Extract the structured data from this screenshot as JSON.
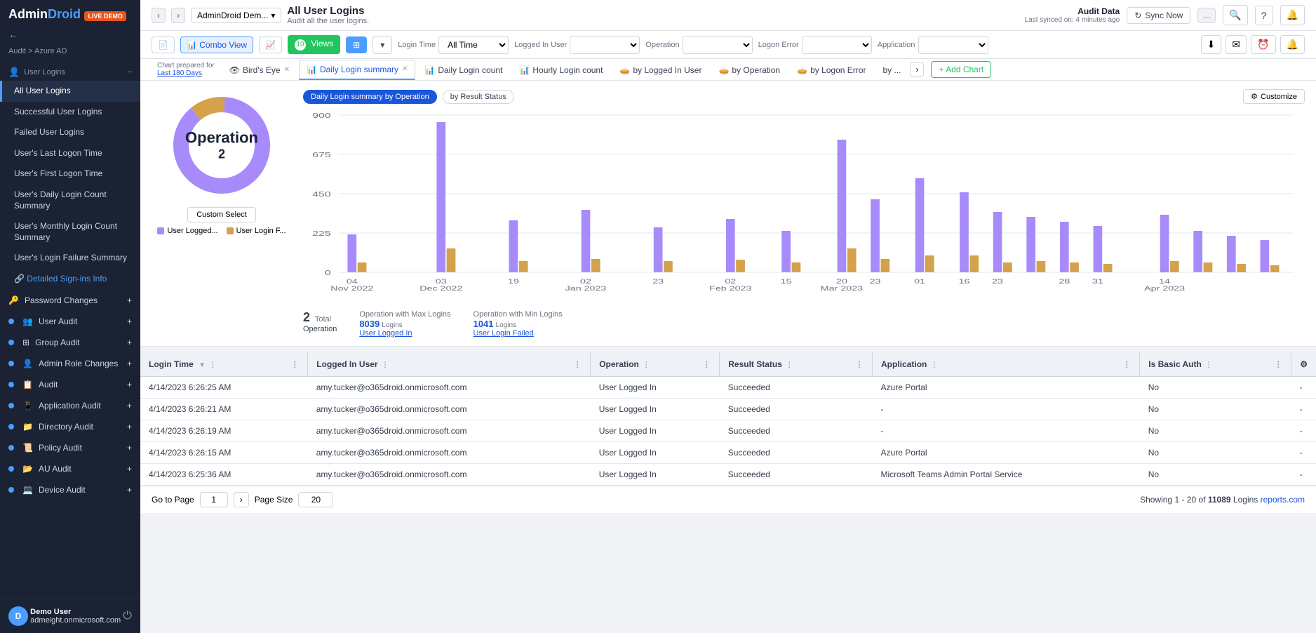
{
  "app": {
    "logo": "AdminDroid",
    "logo_highlight": "Droid",
    "live_demo": "LIVE DEMO"
  },
  "topbar": {
    "nav_back": "‹",
    "nav_forward": "›",
    "breadcrumb": "AdminDroid Dem...",
    "title": "All User Logins",
    "subtitle": "Audit all the user logins.",
    "audit_data_title": "Audit Data",
    "last_synced": "Last synced on: 4 minutes ago",
    "sync_now": "Sync Now",
    "more_options": "...",
    "search_icon": "🔍",
    "help_icon": "?",
    "bell_icon": "🔔"
  },
  "filters": {
    "view1_icon": "📄",
    "combo_view": "Combo View",
    "chart_view": "📊",
    "views_count": "10",
    "views_label": "Views",
    "filter_icon": "⊞",
    "login_time_label": "Login Time",
    "login_time_value": "All Time",
    "logged_in_user_label": "Logged In User",
    "operation_label": "Operation",
    "logon_error_label": "Logon Error",
    "application_label": "Application",
    "download_icon": "⬇",
    "mail_icon": "✉",
    "clock_icon": "⏰",
    "alert_icon": "🔔"
  },
  "chart_tabs": {
    "prepared_for": "Chart prepared for",
    "days": "Last 180 Days",
    "birds_eye": "Bird's Eye",
    "daily_login_summary": "Daily Login summary",
    "daily_login_count": "Daily Login count",
    "hourly_login_count": "Hourly Login count",
    "by_logged_in_user": "by Logged In User",
    "by_operation": "by Operation",
    "by_logon_error": "by Logon Error",
    "by_arrow": "by ...",
    "add_chart": "+ Add Chart"
  },
  "chart": {
    "sub_tabs": [
      "Daily Login summary by Operation",
      "by Result Status"
    ],
    "active_sub_tab": 0,
    "customize": "Customize",
    "donut": {
      "label": "Operation",
      "count": "2",
      "custom_select": "Custom Select",
      "legend": [
        {
          "label": "User Logged...",
          "color": "#a78bfa"
        },
        {
          "label": "User Login F...",
          "color": "#d4a24a"
        }
      ]
    },
    "bar_chart": {
      "y_labels": [
        "900",
        "675",
        "450",
        "225",
        "0"
      ],
      "x_labels": [
        {
          "label": "04",
          "month": "Nov 2022"
        },
        {
          "label": "03",
          "month": "Dec 2022"
        },
        {
          "label": "19",
          "month": ""
        },
        {
          "label": "02",
          "month": "Jan 2023"
        },
        {
          "label": "23",
          "month": ""
        },
        {
          "label": "02",
          "month": "Feb 2023"
        },
        {
          "label": "15",
          "month": ""
        },
        {
          "label": "20",
          "month": "Mar 2023"
        },
        {
          "label": "23",
          "month": ""
        },
        {
          "label": "01",
          "month": ""
        },
        {
          "label": "16",
          "month": ""
        },
        {
          "label": "23",
          "month": ""
        },
        {
          "label": "28",
          "month": ""
        },
        {
          "label": "31",
          "month": ""
        },
        {
          "label": "14",
          "month": "Apr 2023"
        }
      ]
    },
    "stats": {
      "total_operation": "2",
      "total_operation_label": "Total",
      "total_operation_sub": "Operation",
      "max_logins_label": "Operation with Max Logins",
      "max_logins_name": "User Logged In",
      "max_logins_count": "8039",
      "max_logins_unit": "Logins",
      "min_logins_label": "Operation with Min Logins",
      "min_logins_name": "User Login Failed",
      "min_logins_count": "1041",
      "min_logins_unit": "Logins"
    }
  },
  "table": {
    "columns": [
      {
        "label": "Login Time",
        "sortable": true
      },
      {
        "label": "Logged In User",
        "sortable": false
      },
      {
        "label": "Operation",
        "sortable": false
      },
      {
        "label": "Result Status",
        "sortable": false
      },
      {
        "label": "Application",
        "sortable": false
      },
      {
        "label": "Is Basic Auth",
        "sortable": false
      }
    ],
    "rows": [
      {
        "login_time": "4/14/2023 6:26:25 AM",
        "user": "amy.tucker@o365droid.onmicrosoft.com",
        "operation": "User Logged In",
        "result": "Succeeded",
        "application": "Azure Portal",
        "is_basic_auth": "No"
      },
      {
        "login_time": "4/14/2023 6:26:21 AM",
        "user": "amy.tucker@o365droid.onmicrosoft.com",
        "operation": "User Logged In",
        "result": "Succeeded",
        "application": "-",
        "is_basic_auth": "No"
      },
      {
        "login_time": "4/14/2023 6:26:19 AM",
        "user": "amy.tucker@o365droid.onmicrosoft.com",
        "operation": "User Logged In",
        "result": "Succeeded",
        "application": "-",
        "is_basic_auth": "No"
      },
      {
        "login_time": "4/14/2023 6:26:15 AM",
        "user": "amy.tucker@o365droid.onmicrosoft.com",
        "operation": "User Logged In",
        "result": "Succeeded",
        "application": "Azure Portal",
        "is_basic_auth": "No"
      },
      {
        "login_time": "4/14/2023 6:25:36 AM",
        "user": "amy.tucker@o365droid.onmicrosoft.com",
        "operation": "User Logged In",
        "result": "Succeeded",
        "application": "Microsoft Teams Admin Portal Service",
        "is_basic_auth": "No"
      }
    ]
  },
  "pagination": {
    "go_to_page_label": "Go to Page",
    "page_value": "1",
    "page_size_label": "Page Size",
    "page_size_value": "20",
    "showing": "Showing 1 - 20 of",
    "total": "11089",
    "logins": "Logins",
    "reports_link": "reports.com"
  },
  "sidebar": {
    "back_arrow": "←",
    "breadcrumb": "Audit > Azure AD",
    "user_logins": {
      "label": "User Logins",
      "collapse": "−",
      "items": [
        "All User Logins",
        "Successful User Logins",
        "Failed User Logins",
        "User's Last Logon Time",
        "User's First Logon Time",
        "User's Daily Login Count Summary",
        "User's Monthly Login Count Summary",
        "User's Login Failure Summary",
        "Detailed Sign-ins Info"
      ]
    },
    "groups": [
      {
        "label": "Password Changes",
        "dot": "blue",
        "expand": "+"
      },
      {
        "label": "User Audit",
        "dot": "blue",
        "expand": "+"
      },
      {
        "label": "Group Audit",
        "dot": "blue",
        "expand": "+"
      },
      {
        "label": "Admin Role Changes",
        "dot": "blue",
        "expand": "+"
      },
      {
        "label": "Application Audit",
        "dot": "blue",
        "expand": "+"
      },
      {
        "label": "Directory Audit",
        "dot": "blue",
        "expand": "+"
      },
      {
        "label": "Policy Audit",
        "dot": "blue",
        "expand": "+"
      },
      {
        "label": "AU Audit",
        "dot": "blue",
        "expand": "+"
      },
      {
        "label": "Device Audit",
        "dot": "blue",
        "expand": "+"
      }
    ],
    "footer": {
      "user_name": "Demo User",
      "user_email": "admeight.onmicrosoft.com",
      "power_icon": "⏻"
    }
  }
}
